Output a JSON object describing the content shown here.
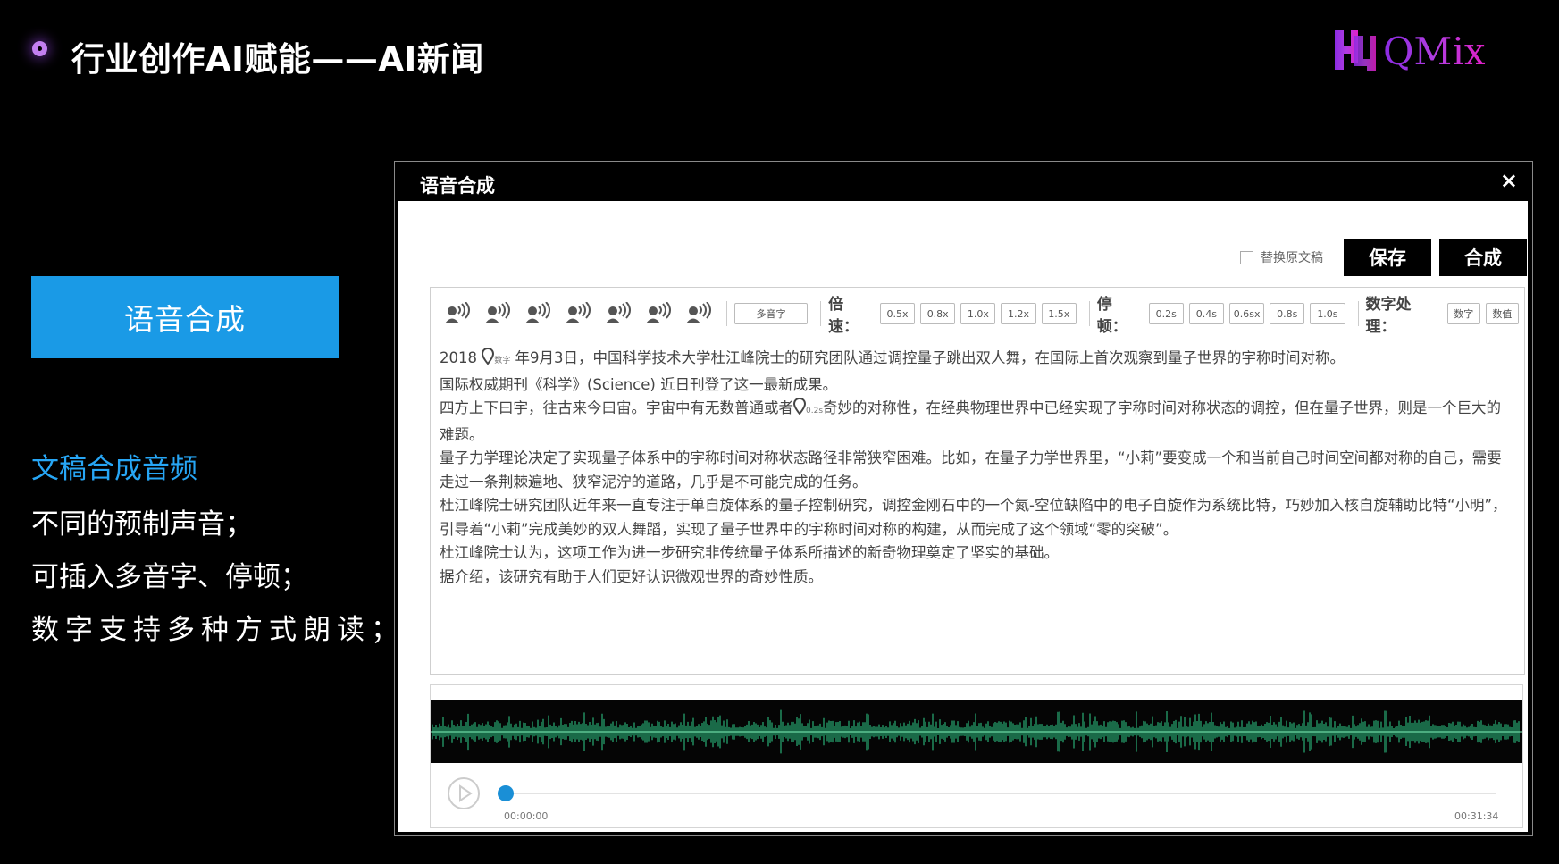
{
  "header": {
    "title": "行业创作AI赋能——AI新闻",
    "logo_text": "QMix"
  },
  "feature_button": "语音合成",
  "description": {
    "heading": "文稿合成音频",
    "lines": [
      "不同的预制声音；",
      "可插入多音字、停顿；",
      "数字支持多种方式朗读；"
    ]
  },
  "dialog": {
    "title": "语音合成",
    "close": "×",
    "replace_label": "替换原文稿",
    "save_label": "保存",
    "synth_label": "合成",
    "toolbar": {
      "polyphone_label": "多音字",
      "speed_label": "倍速：",
      "speed_options": [
        "0.5x",
        "0.8x",
        "1.0x",
        "1.2x",
        "1.5x"
      ],
      "pause_label": "停顿：",
      "pause_options": [
        "0.2s",
        "0.4s",
        "0.6sx",
        "0.8s",
        "1.0s"
      ],
      "number_label": "数字处理：",
      "number_options": [
        "数字",
        "数值"
      ]
    },
    "paragraphs": [
      {
        "pre": "2018",
        "tag": "数字",
        "post": "年9月3日，中国科学技术大学杜江峰院士的研究团队通过调控量子跳出双人舞，在国际上首次观察到量子世界的宇称时间对称。"
      },
      {
        "text": "国际权威期刊《科学》(Science) 近日刊登了这一最新成果。"
      },
      {
        "pre": "四方上下曰宇，往古来今曰宙。宇宙中有无数普通或者",
        "tag": "0.2s",
        "post": "奇妙的对称性，在经典物理世界中已经实现了宇称时间对称状态的调控，但在量子世界，则是一个巨大的难题。"
      },
      {
        "text": "量子力学理论决定了实现量子体系中的宇称时间对称状态路径非常狭窄困难。比如，在量子力学世界里，“小莉”要变成一个和当前自己时间空间都对称的自己，需要走过一条荆棘遍地、狭窄泥泞的道路，几乎是不可能完成的任务。"
      },
      {
        "text": "杜江峰院士研究团队近年来一直专注于单自旋体系的量子控制研究，调控金刚石中的一个氮-空位缺陷中的电子自旋作为系统比特，巧妙加入核自旋辅助比特“小明”，引导着“小莉”完成美妙的双人舞蹈，实现了量子世界中的宇称时间对称的构建，从而完成了这个领域“零的突破”。"
      },
      {
        "text": "杜江峰院士认为，这项工作为进一步研究非传统量子体系所描述的新奇物理奠定了坚实的基础。"
      },
      {
        "text": "据介绍，该研究有助于人们更好认识微观世界的奇妙性质。"
      }
    ],
    "player": {
      "progress": 0,
      "time_start": "00:00:00",
      "time_end": "00:31:34"
    }
  }
}
